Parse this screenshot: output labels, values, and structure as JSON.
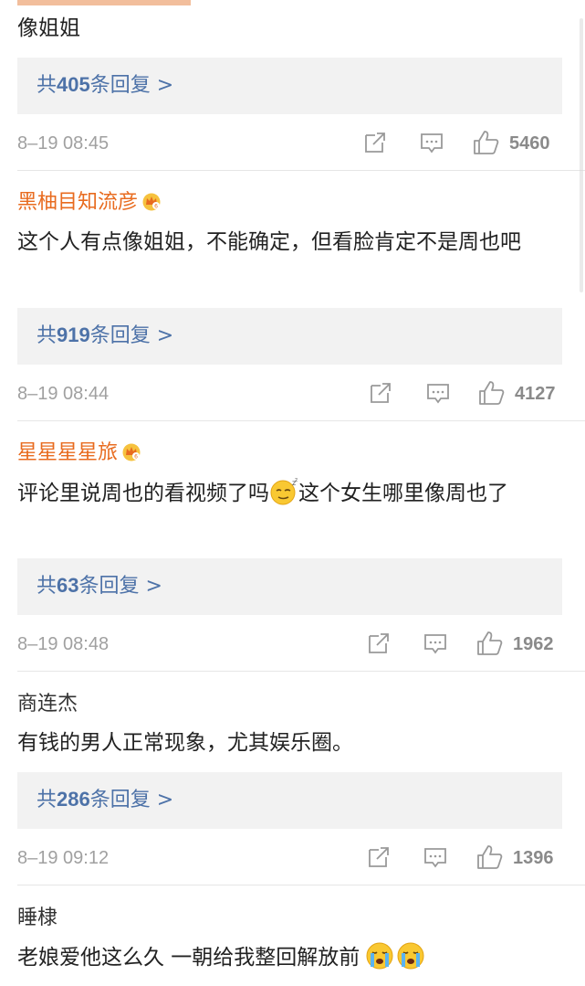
{
  "comments": [
    {
      "content": "像姐姐",
      "reply_prefix": "共",
      "reply_count": "405",
      "reply_suffix": "条回复 >",
      "time": "8–19 08:45",
      "likes": "5460"
    },
    {
      "author": "黑柚目知流彦",
      "content": "这个人有点像姐姐，不能确定，但看脸肯定不是周也吧",
      "reply_prefix": "共",
      "reply_count": "919",
      "reply_suffix": "条回复 >",
      "time": "8–19 08:44",
      "likes": "4127"
    },
    {
      "author": "星星星星旅",
      "content_a": "评论里说周也的看视频了吗",
      "content_b": "这个女生哪里像周也了",
      "reply_prefix": "共",
      "reply_count": "63",
      "reply_suffix": "条回复 >",
      "time": "8–19 08:48",
      "likes": "1962"
    },
    {
      "author": "商连杰",
      "content": "有钱的男人正常现象，尤其娱乐圈。",
      "reply_prefix": "共",
      "reply_count": "286",
      "reply_suffix": "条回复 >",
      "time": "8–19 09:12",
      "likes": "1396"
    },
    {
      "author": "睡棣",
      "content": "老娘爱他这么久 一朝给我整回解放前"
    }
  ],
  "icons": {
    "share": "share-icon",
    "comment": "comment-icon",
    "like": "like-icon",
    "crown": "crown-badge-icon",
    "sleepy_emoji": "sleepy-emoji",
    "crying_emoji": "crying-emoji"
  },
  "colors": {
    "author": "#e86b1f",
    "reply_link": "#4d72a8",
    "reply_bg": "#f2f2f2",
    "meta": "#a0a0a0"
  }
}
